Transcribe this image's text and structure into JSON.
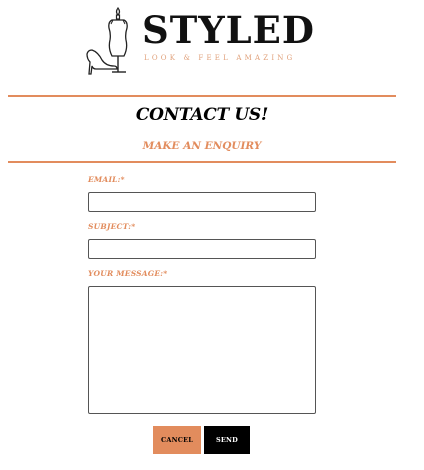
{
  "brand": {
    "name": "STYLED",
    "tagline": "LOOK & FEEL AMAZING",
    "icon": "mannequin-heel-icon",
    "accent_color": "#e28c5d"
  },
  "page": {
    "title": "CONTACT US!",
    "subtitle": "MAKE AN ENQUIRY"
  },
  "form": {
    "email": {
      "label": "EMAIL:*",
      "value": "",
      "placeholder": ""
    },
    "subject": {
      "label": "SUBJECT:*",
      "value": "",
      "placeholder": ""
    },
    "message": {
      "label": "YOUR MESSAGE:*",
      "value": "",
      "placeholder": ""
    },
    "cancel_label": "CANCEL",
    "send_label": "SEND",
    "cancel_color": "#e28c5d",
    "send_color": "#000000"
  }
}
